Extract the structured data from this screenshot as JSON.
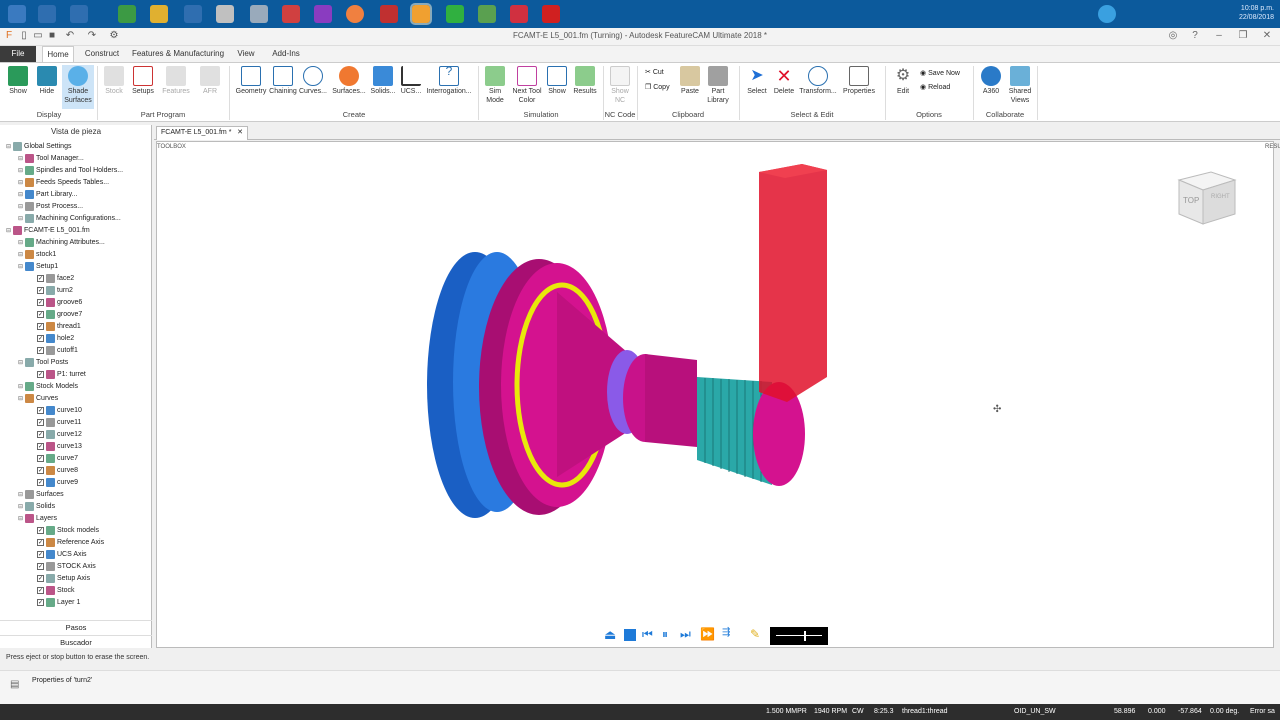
{
  "window": {
    "title": "FCAMT-E L5_001.fm (Turning) - Autodesk FeatureCAM Ultimate 2018 *"
  },
  "taskbar": {
    "clock_line1": "10:08 p.m.",
    "clock_line2": "22/08/2018"
  },
  "ribbon_tabs": [
    "File",
    "Home",
    "Construct",
    "Features & Manufacturing",
    "View",
    "Add-Ins"
  ],
  "ribbon": {
    "display": {
      "show": "Show",
      "hide": "Hide",
      "shade1": "Shade",
      "shade2": "Surfaces",
      "label": "Display"
    },
    "part_program": {
      "stock": "Stock",
      "setups": "Setups",
      "features": "Features",
      "afr": "AFR",
      "label": "Part Program"
    },
    "create": {
      "geometry": "Geometry",
      "chaining": "Chaining",
      "curves": "Curves...",
      "surfaces": "Surfaces...",
      "solids": "Solids...",
      "ucs": "UCS...",
      "interrogation": "Interrogation...",
      "label": "Create"
    },
    "simulation": {
      "sim1": "Sim",
      "sim2": "Mode",
      "next1": "Next Tool",
      "next2": "Color",
      "show": "Show",
      "results": "Results",
      "label": "Simulation"
    },
    "nc": {
      "show1": "Show",
      "show2": "NC",
      "label": "NC Code"
    },
    "clipboard": {
      "cut": "Cut",
      "copy": "Copy",
      "paste": "Paste",
      "pl1": "Part",
      "pl2": "Library",
      "label": "Clipboard"
    },
    "select_edit": {
      "select": "Select",
      "delete": "Delete",
      "transform": "Transform...",
      "properties": "Properties",
      "label": "Select & Edit"
    },
    "options": {
      "edit": "Edit",
      "save_now": "Save Now",
      "reload": "Reload",
      "label": "Options"
    },
    "collaborate": {
      "a360": "A360",
      "sv1": "Shared",
      "sv2": "Views",
      "label": "Collaborate"
    }
  },
  "left_panel": {
    "title": "Vista de pieza",
    "tree": [
      {
        "label": "Global Settings",
        "indent": 0
      },
      {
        "label": "Tool Manager...",
        "indent": 1
      },
      {
        "label": "Spindles and Tool Holders...",
        "indent": 1
      },
      {
        "label": "Feeds  Speeds Tables...",
        "indent": 1
      },
      {
        "label": "Part Library...",
        "indent": 1
      },
      {
        "label": "Post Process...",
        "indent": 1
      },
      {
        "label": "Machining Configurations...",
        "indent": 1
      },
      {
        "label": "FCAMT-E L5_001.fm",
        "indent": 0
      },
      {
        "label": "Machining Attributes...",
        "indent": 1
      },
      {
        "label": "stock1",
        "indent": 1
      },
      {
        "label": "Setup1",
        "indent": 1
      },
      {
        "label": "face2",
        "indent": 2
      },
      {
        "label": "turn2",
        "indent": 2
      },
      {
        "label": "groove6",
        "indent": 2
      },
      {
        "label": "groove7",
        "indent": 2
      },
      {
        "label": "thread1",
        "indent": 2
      },
      {
        "label": "hole2",
        "indent": 2
      },
      {
        "label": "cutoff1",
        "indent": 2
      },
      {
        "label": "Tool Posts",
        "indent": 1
      },
      {
        "label": "P1: turret",
        "indent": 2
      },
      {
        "label": "Stock Models",
        "indent": 1
      },
      {
        "label": "Curves",
        "indent": 1
      },
      {
        "label": "curve10",
        "indent": 2
      },
      {
        "label": "curve11",
        "indent": 2
      },
      {
        "label": "curve12",
        "indent": 2
      },
      {
        "label": "curve13",
        "indent": 2
      },
      {
        "label": "curve7",
        "indent": 2
      },
      {
        "label": "curve8",
        "indent": 2
      },
      {
        "label": "curve9",
        "indent": 2
      },
      {
        "label": "Surfaces",
        "indent": 1
      },
      {
        "label": "Solids",
        "indent": 1
      },
      {
        "label": "Layers",
        "indent": 1
      },
      {
        "label": "Stock models",
        "indent": 2
      },
      {
        "label": "Reference Axis",
        "indent": 2
      },
      {
        "label": "UCS Axis",
        "indent": 2
      },
      {
        "label": "STOCK Axis",
        "indent": 2
      },
      {
        "label": "Setup Axis",
        "indent": 2
      },
      {
        "label": "Stock",
        "indent": 2
      },
      {
        "label": "Layer 1",
        "indent": 2
      }
    ],
    "pasos": "Pasos",
    "buscador": "Buscador"
  },
  "doc_tab": "FCAMT-E L5_001.fm *",
  "viewport": {
    "toolbox": "TOOLBOX",
    "results": "RESULTS",
    "viewcube_top": "TOP",
    "viewcube_right": "RIGHT"
  },
  "status_message": "Press eject or stop button to erase the screen.",
  "properties_label": "Properties of 'turn2'",
  "statusbar": {
    "feed": "1.500 MMPR",
    "rpm": "1940 RPM",
    "dir": "CW",
    "time": "8:25.3",
    "op": "thread1:thread",
    "view": "OID_UN_SW",
    "x": "58.896",
    "y": "0.000",
    "z": "-57.864",
    "angle": "0.00 deg.",
    "error": "Error sa"
  },
  "colors": {
    "taskbar": "#0c5a9c",
    "part_magenta": "#d4128f",
    "part_blue": "#1e6fd6",
    "thread_cyan": "#2aa8a8",
    "tool_red": "#e0102a",
    "groove_yellow": "#e8e80a"
  }
}
